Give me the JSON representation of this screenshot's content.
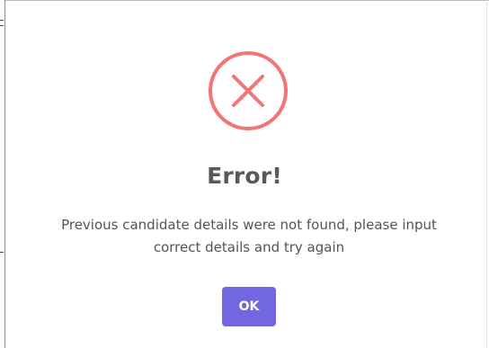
{
  "dialog": {
    "icon": "error-x-circle-icon",
    "title": "Error!",
    "message_line1": "Previous candidate details were not found, please input",
    "message_line2": "correct details and try again",
    "ok_label": "OK"
  },
  "colors": {
    "icon": "#f27474",
    "title": "#595959",
    "message": "#545454",
    "button_bg": "#7367e0",
    "button_text": "#ffffff"
  }
}
